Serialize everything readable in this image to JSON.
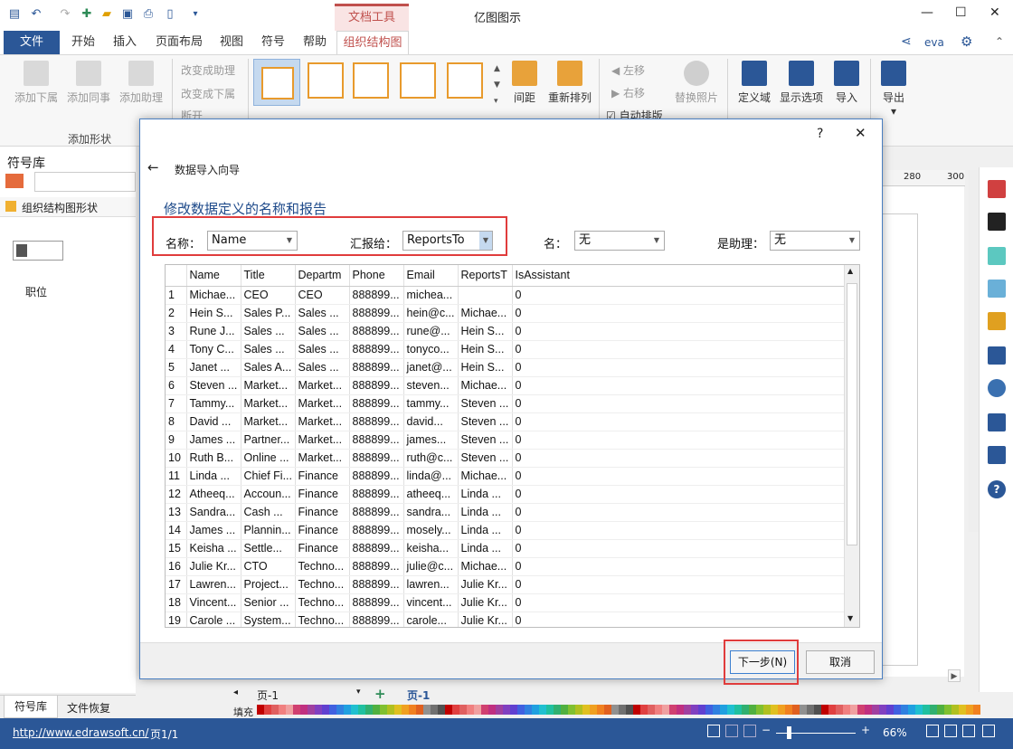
{
  "app": {
    "title": "亿图图示",
    "context_tab": "文档工具",
    "user": "eva"
  },
  "tabs": [
    "文件",
    "开始",
    "插入",
    "页面布局",
    "视图",
    "符号",
    "帮助",
    "组织结构图"
  ],
  "ribbon": {
    "add_shape": {
      "buttons": [
        "添加下属",
        "添加同事",
        "添加助理"
      ],
      "group_label": "添加形状"
    },
    "change": [
      "改变成助理",
      "改变成下属",
      "断开"
    ],
    "spacing": "间距",
    "rearrange": "重新排列",
    "move_left": "左移",
    "move_right": "右移",
    "auto_layout": "自动排版",
    "replace_photo": "替换照片",
    "define_domain": "定义域",
    "show_options": "显示选项",
    "import": "导入",
    "export": "导出"
  },
  "left_panel": {
    "title": "符号库",
    "category": "组织结构图形状",
    "shape_label": "职位",
    "tabs": [
      "符号库",
      "文件恢复"
    ]
  },
  "ruler": [
    "280",
    "300"
  ],
  "page_tabs": {
    "page": "页-1",
    "active": "页-1",
    "fill_label": "填充"
  },
  "status": {
    "url": "http://www.edrawsoft.cn/",
    "page": "页1/1",
    "zoom": "66%"
  },
  "dialog": {
    "help": "?",
    "close": "✕",
    "back": "←",
    "title": "数据导入向导",
    "heading": "修改数据定义的名称和报告",
    "fields": {
      "name_label": "名称：",
      "name_value": "Name",
      "report_label": "汇报给：",
      "report_value": "ReportsTo",
      "first_label": "名：",
      "first_value": "无",
      "assistant_label": "是助理：",
      "assistant_value": "无"
    },
    "columns": [
      "",
      "Name",
      "Title",
      "Departm",
      "Phone",
      "Email",
      "ReportsT",
      "IsAssistant"
    ],
    "rows": [
      [
        "1",
        "Michae...",
        "CEO",
        "CEO",
        "888899...",
        "michea...",
        "",
        "0"
      ],
      [
        "2",
        "Hein S...",
        "Sales P...",
        "Sales ...",
        "888899...",
        "hein@c...",
        "Michae...",
        "0"
      ],
      [
        "3",
        "Rune J...",
        "Sales ...",
        "Sales ...",
        "888899...",
        "rune@...",
        "Hein S...",
        "0"
      ],
      [
        "4",
        "Tony C...",
        "Sales ...",
        "Sales ...",
        "888899...",
        "tonyco...",
        "Hein S...",
        "0"
      ],
      [
        "5",
        "Janet ...",
        "Sales A...",
        "Sales ...",
        "888899...",
        "janet@...",
        "Hein S...",
        "0"
      ],
      [
        "6",
        "Steven ...",
        "Market...",
        "Market...",
        "888899...",
        "steven...",
        "Michae...",
        "0"
      ],
      [
        "7",
        "Tammy...",
        "Market...",
        "Market...",
        "888899...",
        "tammy...",
        "Steven ...",
        "0"
      ],
      [
        "8",
        "David ...",
        "Market...",
        "Market...",
        "888899...",
        "david...",
        "Steven ...",
        "0"
      ],
      [
        "9",
        "James ...",
        "Partner...",
        "Market...",
        "888899...",
        "james...",
        "Steven ...",
        "0"
      ],
      [
        "10",
        "Ruth B...",
        "Online ...",
        "Market...",
        "888899...",
        "ruth@c...",
        "Steven ...",
        "0"
      ],
      [
        "11",
        "Linda ...",
        "Chief Fi...",
        "Finance",
        "888899...",
        "linda@...",
        "Michae...",
        "0"
      ],
      [
        "12",
        "Atheeq...",
        "Accoun...",
        "Finance",
        "888899...",
        "atheeq...",
        "Linda ...",
        "0"
      ],
      [
        "13",
        "Sandra...",
        "Cash ...",
        "Finance",
        "888899...",
        "sandra...",
        "Linda ...",
        "0"
      ],
      [
        "14",
        "James ...",
        "Plannin...",
        "Finance",
        "888899...",
        "mosely...",
        "Linda ...",
        "0"
      ],
      [
        "15",
        "Keisha ...",
        "Settle...",
        "Finance",
        "888899...",
        "keisha...",
        "Linda ...",
        "0"
      ],
      [
        "16",
        "Julie Kr...",
        "CTO",
        "Techno...",
        "888899...",
        "julie@c...",
        "Michae...",
        "0"
      ],
      [
        "17",
        "Lawren...",
        "Project...",
        "Techno...",
        "888899...",
        "lawren...",
        "Julie Kr...",
        "0"
      ],
      [
        "18",
        "Vincent...",
        "Senior ...",
        "Techno...",
        "888899...",
        "vincent...",
        "Julie Kr...",
        "0"
      ],
      [
        "19",
        "Carole ...",
        "System...",
        "Techno...",
        "888899...",
        "carole...",
        "Julie Kr...",
        "0"
      ]
    ],
    "next": "下一步(N)",
    "cancel": "取消"
  },
  "colors": {
    "accent": "#2b5797",
    "context": "#c0504d",
    "highlight": "#e03c3c"
  }
}
